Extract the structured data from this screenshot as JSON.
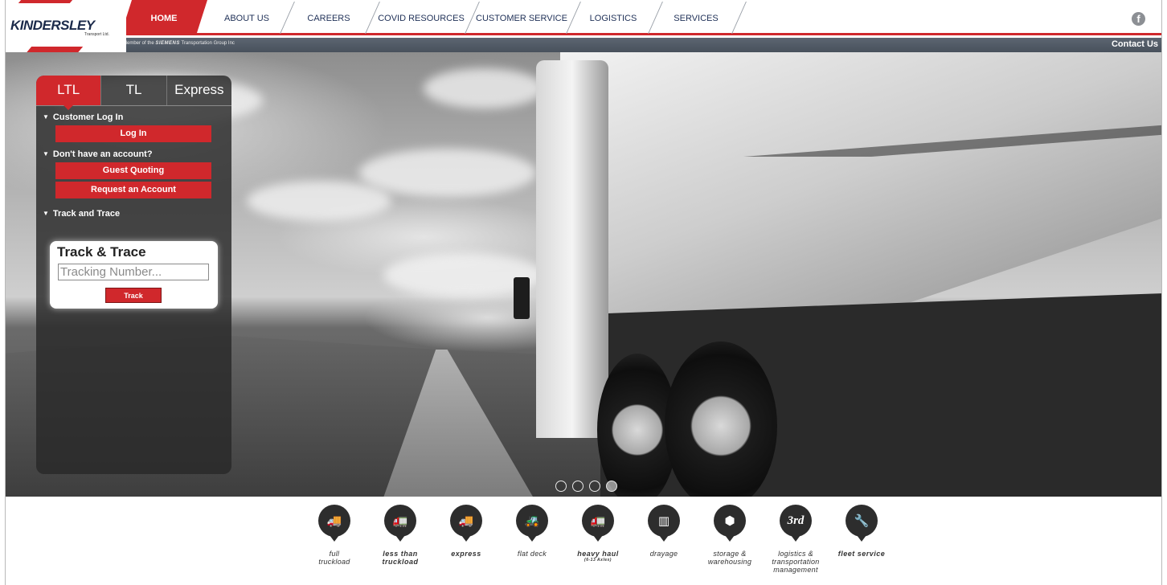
{
  "header": {
    "logo_text": "KINDERSLEY",
    "logo_sub": "Transport Ltd.",
    "member_prefix": "a Member of the",
    "member_brand": "SIEMENS",
    "member_suffix": "Transportation Group Inc",
    "contact_label": "Contact Us",
    "facebook_icon": "facebook-icon",
    "nav": [
      {
        "label": "HOME",
        "active": true
      },
      {
        "label": "ABOUT US"
      },
      {
        "label": "CAREERS"
      },
      {
        "label": "COVID RESOURCES"
      },
      {
        "label": "CUSTOMER SERVICE"
      },
      {
        "label": "LOGISTICS"
      },
      {
        "label": "SERVICES"
      }
    ]
  },
  "panel": {
    "tabs": [
      {
        "label": "LTL",
        "active": true
      },
      {
        "label": "TL"
      },
      {
        "label": "Express"
      }
    ],
    "customer_login_heading": "Customer Log In",
    "login_button": "Log In",
    "no_account_heading": "Don't have an account?",
    "guest_quoting_button": "Guest Quoting",
    "request_account_button": "Request an Account",
    "track_heading": "Track and Trace",
    "track_card_title": "Track & Trace",
    "tracking_placeholder": "Tracking Number...",
    "track_button": "Track"
  },
  "slider": {
    "dot_count": 4,
    "active_index": 3
  },
  "services": [
    {
      "icon": "full-truckload-icon",
      "label": "full",
      "label2": "truckload",
      "glyph": "🚚"
    },
    {
      "icon": "less-than-truckload-icon",
      "label": "less than",
      "label2": "truckload",
      "glyph": "🚛"
    },
    {
      "icon": "express-icon",
      "label": "express",
      "glyph": "🚚"
    },
    {
      "icon": "flat-deck-icon",
      "label": "flat deck",
      "glyph": "🚜"
    },
    {
      "icon": "heavy-haul-icon",
      "label": "heavy haul",
      "sub": "(6-13 Axles)",
      "glyph": "🚛"
    },
    {
      "icon": "drayage-icon",
      "label": "drayage",
      "glyph": "▥"
    },
    {
      "icon": "storage-warehousing-icon",
      "label": "storage &",
      "label2": "warehousing",
      "glyph": "⬢"
    },
    {
      "icon": "logistics-3rd-icon",
      "label": "logistics &",
      "label2": "transportation",
      "label3": "management",
      "glyph": "3rd"
    },
    {
      "icon": "fleet-service-wrench-icon",
      "label": "fleet service",
      "glyph": "🔧"
    }
  ]
}
